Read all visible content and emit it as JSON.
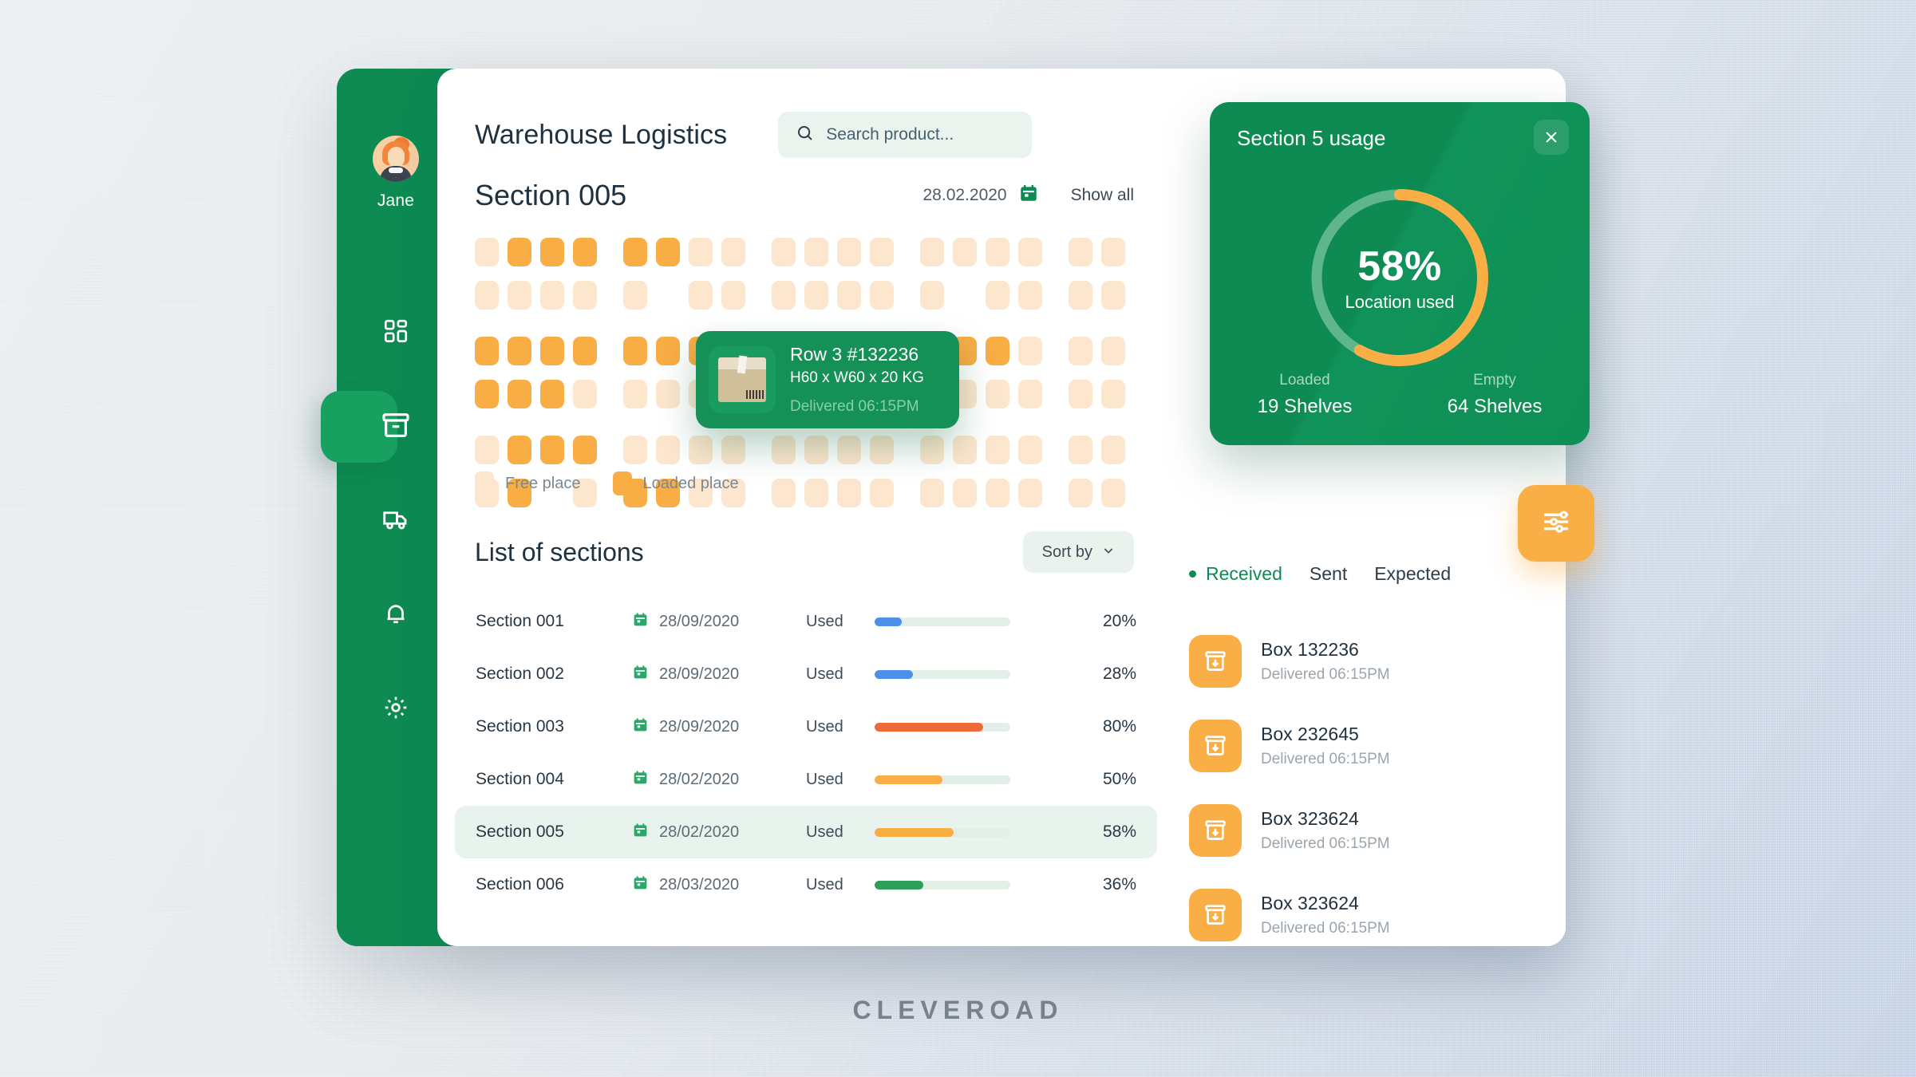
{
  "brand": "CLEVEROAD",
  "sidebar": {
    "user_name": "Jane",
    "items": [
      {
        "name": "dashboard",
        "icon": "grid-icon",
        "active": false
      },
      {
        "name": "inventory",
        "icon": "archive-box-icon",
        "active": true
      },
      {
        "name": "shipping",
        "icon": "truck-icon",
        "active": false
      },
      {
        "name": "notifications",
        "icon": "bell-icon",
        "active": false
      },
      {
        "name": "settings",
        "icon": "gear-icon",
        "active": false
      }
    ]
  },
  "header": {
    "title": "Warehouse Logistics",
    "search_placeholder": "Search product..."
  },
  "section": {
    "title": "Section 005",
    "date": "28.02.2020",
    "show_all": "Show all"
  },
  "legend": [
    {
      "label": "Free place",
      "color": "#fce6cd"
    },
    {
      "label": "Loaded place",
      "color": "#f9ad45"
    }
  ],
  "shelf_grid": {
    "rows": [
      [
        [
          "free",
          "loaded",
          "loaded",
          "loaded"
        ],
        [
          "loaded",
          "loaded",
          "free",
          "free"
        ],
        [
          "free",
          "free",
          "free",
          "free"
        ],
        [
          "free",
          "free",
          "free",
          "free"
        ],
        [
          "free",
          "free"
        ]
      ],
      [
        [
          "free",
          "free",
          "free",
          "free"
        ],
        [
          "free",
          "blank",
          "free",
          "free"
        ],
        [
          "free",
          "free",
          "free",
          "free"
        ],
        [
          "free",
          "blank",
          "free",
          "free"
        ],
        [
          "free",
          "free"
        ]
      ],
      [
        [
          "loaded",
          "loaded",
          "loaded",
          "loaded"
        ],
        [
          "loaded",
          "loaded",
          "loaded",
          "loaded"
        ],
        [
          "loaded",
          "loaded",
          "loaded",
          "loaded"
        ],
        [
          "loaded",
          "loaded",
          "loaded",
          "free"
        ],
        [
          "free",
          "free"
        ]
      ],
      [
        [
          "loaded",
          "loaded",
          "loaded",
          "free"
        ],
        [
          "free",
          "free",
          "free",
          "free"
        ],
        [
          "free",
          "free",
          "free",
          "free"
        ],
        [
          "free",
          "free",
          "free",
          "free"
        ],
        [
          "free",
          "free"
        ]
      ],
      [
        [
          "free",
          "loaded",
          "loaded",
          "loaded"
        ],
        [
          "free",
          "free",
          "free",
          "free"
        ],
        [
          "free",
          "free",
          "free",
          "free"
        ],
        [
          "free",
          "free",
          "free",
          "free"
        ],
        [
          "free",
          "free"
        ]
      ],
      [
        [
          "free",
          "loaded",
          "blank",
          "free"
        ],
        [
          "loaded",
          "loaded",
          "free",
          "free"
        ],
        [
          "free",
          "free",
          "free",
          "free"
        ],
        [
          "free",
          "free",
          "free",
          "free"
        ],
        [
          "free",
          "free"
        ]
      ]
    ]
  },
  "tooltip": {
    "name": "Row 3 #132236",
    "dims": "H60 x W60 x 20 KG",
    "status": "Delivered 06:15PM"
  },
  "list": {
    "title": "List of sections",
    "sort_label": "Sort by",
    "used_label": "Used",
    "rows": [
      {
        "name": "Section 001",
        "date": "28/09/2020",
        "used": "Used",
        "percent": "20%",
        "value": 20,
        "color": "#4c90e8",
        "selected": false
      },
      {
        "name": "Section 002",
        "date": "28/09/2020",
        "used": "Used",
        "percent": "28%",
        "value": 28,
        "color": "#4c90e8",
        "selected": false
      },
      {
        "name": "Section 003",
        "date": "28/09/2020",
        "used": "Used",
        "percent": "80%",
        "value": 80,
        "color": "#ef6a3a",
        "selected": false
      },
      {
        "name": "Section 004",
        "date": "28/02/2020",
        "used": "Used",
        "percent": "50%",
        "value": 50,
        "color": "#f9ad45",
        "selected": false
      },
      {
        "name": "Section 005",
        "date": "28/02/2020",
        "used": "Used",
        "percent": "58%",
        "value": 58,
        "color": "#f9ad45",
        "selected": true
      },
      {
        "name": "Section 006",
        "date": "28/03/2020",
        "used": "Used",
        "percent": "36%",
        "value": 36,
        "color": "#2e9e5b",
        "selected": false
      }
    ]
  },
  "usage_panel": {
    "title": "Section 5 usage",
    "percent_label": "58%",
    "center_sub": "Location used",
    "loaded_label": "Loaded",
    "loaded_value": "19 Shelves",
    "empty_label": "Empty",
    "empty_value": "64 Shelves"
  },
  "chart_data": {
    "type": "pie",
    "title": "Section 5 usage",
    "categories": [
      "Location used",
      "Free"
    ],
    "values": [
      58,
      42
    ],
    "colors": [
      "#f9ae46",
      "#5fb58c"
    ],
    "center_text": "58%",
    "center_sub": "Location used",
    "annotations": [
      "Loaded 19 Shelves",
      "Empty 64 Shelves"
    ]
  },
  "right_panel": {
    "tabs": [
      {
        "label": "Received",
        "active": true
      },
      {
        "label": "Sent",
        "active": false
      },
      {
        "label": "Expected",
        "active": false
      }
    ],
    "boxes": [
      {
        "name": "Box 132236",
        "status": "Delivered 06:15PM"
      },
      {
        "name": "Box 232645",
        "status": "Delivered 06:15PM"
      },
      {
        "name": "Box 323624",
        "status": "Delivered 06:15PM"
      },
      {
        "name": "Box 323624",
        "status": "Delivered 06:15PM"
      }
    ]
  }
}
